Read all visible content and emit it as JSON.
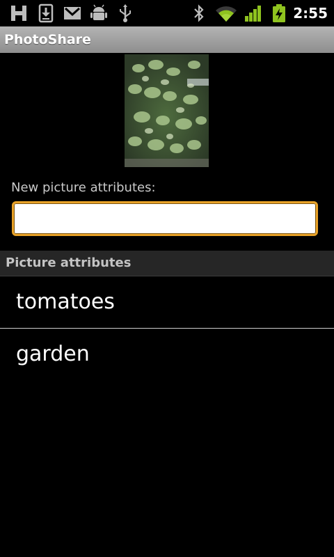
{
  "status_bar": {
    "time": "2:55",
    "icons": [
      "h-network-icon",
      "download-icon",
      "gmail-icon",
      "android-debug-icon",
      "usb-icon",
      "bluetooth-icon",
      "wifi-icon",
      "signal-icon",
      "battery-icon"
    ],
    "accent_color": "#8fc31f"
  },
  "app": {
    "title": "PhotoShare"
  },
  "form": {
    "label": "New picture attributes:",
    "input_value": "",
    "input_border_color": "#e8a228"
  },
  "attributes": {
    "header": "Picture attributes",
    "items": [
      {
        "label": "tomatoes"
      },
      {
        "label": "garden"
      }
    ]
  }
}
